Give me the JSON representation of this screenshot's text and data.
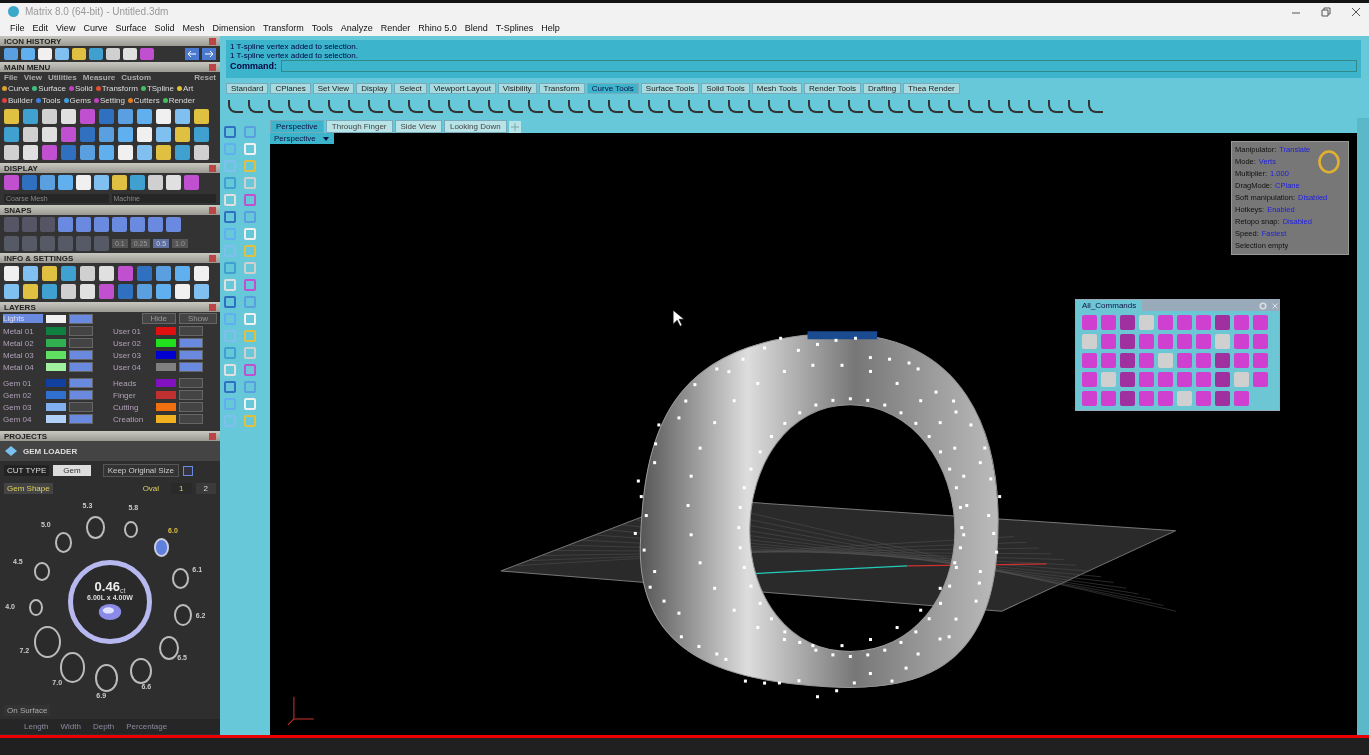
{
  "window": {
    "title": "Matrix 8.0 (64-bit) - Untitled.3dm"
  },
  "menu": [
    "File",
    "Edit",
    "View",
    "Curve",
    "Surface",
    "Solid",
    "Mesh",
    "Dimension",
    "Transform",
    "Tools",
    "Analyze",
    "Render",
    "Rhino 5.0",
    "Blend",
    "T-Splines",
    "Help"
  ],
  "icon_history": {
    "title": "ICON HISTORY"
  },
  "main_menu": {
    "title": "MAIN MENU",
    "items": [
      "File",
      "View",
      "Utilities",
      "Measure",
      "Custom"
    ],
    "reset": "Reset",
    "modules": [
      {
        "label": "Curve",
        "color": "#e0a030"
      },
      {
        "label": "Surface",
        "color": "#40c080"
      },
      {
        "label": "Solid",
        "color": "#c040c0"
      },
      {
        "label": "Transform",
        "color": "#e05030"
      },
      {
        "label": "TSpline",
        "color": "#40c060"
      },
      {
        "label": "Art",
        "color": "#e0c030"
      },
      {
        "label": "Builder",
        "color": "#e04040"
      },
      {
        "label": "Tools",
        "color": "#4080e0"
      },
      {
        "label": "Gems",
        "color": "#40a0e0"
      },
      {
        "label": "Setting",
        "color": "#c040c0"
      },
      {
        "label": "Cutters",
        "color": "#e08020"
      },
      {
        "label": "Render",
        "color": "#40c060"
      }
    ]
  },
  "display": {
    "title": "DISPLAY",
    "mesh": "Coarse Mesh",
    "material": "Machine"
  },
  "snaps": {
    "title": "SNAPS",
    "steps": [
      {
        "label": "0.1",
        "selected": false
      },
      {
        "label": "0.25",
        "selected": false
      },
      {
        "label": "0.5",
        "selected": true
      },
      {
        "label": "1.0",
        "selected": false
      }
    ]
  },
  "info_settings": {
    "title": "INFO & SETTINGS"
  },
  "layers": {
    "title": "LAYERS",
    "lights": {
      "name": "Lights",
      "on": true
    },
    "hide": "Hide",
    "show": "Show",
    "groups": [
      [
        {
          "name": "Metal 01",
          "color": "#108040",
          "on": false
        },
        {
          "name": "Metal 02",
          "color": "#30b050",
          "on": false
        },
        {
          "name": "Metal 03",
          "color": "#60e060",
          "on": true
        },
        {
          "name": "Metal 04",
          "color": "#a0f0a0",
          "on": true
        }
      ],
      [
        {
          "name": "User 01",
          "color": "#e01010",
          "on": false
        },
        {
          "name": "User 02",
          "color": "#20e020",
          "on": true
        },
        {
          "name": "User 03",
          "color": "#0000d0",
          "on": true
        },
        {
          "name": "User 04",
          "color": "#808080",
          "on": true
        }
      ],
      [
        {
          "name": "Gem 01",
          "color": "#1040a0",
          "on": true
        },
        {
          "name": "Gem 02",
          "color": "#3070d0",
          "on": true
        },
        {
          "name": "Gem 03",
          "color": "#80b0f0",
          "on": false
        },
        {
          "name": "Gem 04",
          "color": "#b0d0f8",
          "on": true
        }
      ],
      [
        {
          "name": "Heads",
          "color": "#8010c0",
          "on": false
        },
        {
          "name": "Finger",
          "color": "#c03030",
          "on": false
        },
        {
          "name": "Cutting",
          "color": "#f07010",
          "on": false
        },
        {
          "name": "Creation",
          "color": "#f0b020",
          "on": false
        }
      ]
    ]
  },
  "projects": {
    "title": "PROJECTS"
  },
  "gem_loader": {
    "title": "GEM LOADER",
    "cut_type_label": "CUT TYPE",
    "cut_type": "Gem",
    "keep_size": "Keep Original Size",
    "keep_size_checked": false,
    "shape_label": "Gem Shape",
    "shape": "Oval",
    "pages": [
      {
        "label": "1",
        "selected": true
      },
      {
        "label": "2",
        "selected": false
      }
    ],
    "carat": "0.46",
    "carat_unit": "ct",
    "dimensions": "6.00L x 4.00W",
    "sizes": [
      {
        "label": "5.8",
        "selected": false
      },
      {
        "label": "6.0",
        "selected": true
      },
      {
        "label": "6.1",
        "selected": false
      },
      {
        "label": "6.2",
        "selected": false
      },
      {
        "label": "6.5",
        "selected": false
      },
      {
        "label": "6.6",
        "selected": false
      },
      {
        "label": "6.9",
        "selected": false
      },
      {
        "label": "7.0",
        "selected": false
      },
      {
        "label": "7.2",
        "selected": false
      },
      {
        "label": "4.0",
        "selected": false
      },
      {
        "label": "4.5",
        "selected": false
      },
      {
        "label": "5.0",
        "selected": false
      },
      {
        "label": "5.3",
        "selected": false
      }
    ],
    "on_surface": "On Surface",
    "columns": [
      "Length",
      "Width",
      "Depth",
      "Percentage"
    ]
  },
  "command": {
    "history": [
      "1 T-spline vertex added to selection.",
      "1 T-spline vertex added to selection."
    ],
    "label": "Command:"
  },
  "toolbar_tabs": [
    {
      "label": "Standard",
      "selected": false
    },
    {
      "label": "CPlanes",
      "selected": false
    },
    {
      "label": "Set View",
      "selected": false
    },
    {
      "label": "Display",
      "selected": false
    },
    {
      "label": "Select",
      "selected": false
    },
    {
      "label": "Viewport Layout",
      "selected": false
    },
    {
      "label": "Visibility",
      "selected": false
    },
    {
      "label": "Transform",
      "selected": false
    },
    {
      "label": "Curve Tools",
      "selected": true
    },
    {
      "label": "Surface Tools",
      "selected": false
    },
    {
      "label": "Solid Tools",
      "selected": false
    },
    {
      "label": "Mesh Tools",
      "selected": false
    },
    {
      "label": "Render Tools",
      "selected": false
    },
    {
      "label": "Drafting",
      "selected": false
    },
    {
      "label": "Thea Render",
      "selected": false
    }
  ],
  "viewport_tabs": [
    {
      "label": "Perspective",
      "selected": true
    },
    {
      "label": "Through Finger",
      "selected": false
    },
    {
      "label": "Side View",
      "selected": false
    },
    {
      "label": "Looking Down",
      "selected": false
    }
  ],
  "viewport": {
    "label": "Perspective"
  },
  "tspline_info": [
    {
      "label": "Manipulator:",
      "value": "Translate"
    },
    {
      "label": "Mode:",
      "value": "Verts"
    },
    {
      "label": "Multiplier:",
      "value": "1.000"
    },
    {
      "label": "DragMode:",
      "value": "CPlane"
    },
    {
      "label": "Soft manipulation:",
      "value": "Disabled"
    },
    {
      "label": "Hotkeys:",
      "value": "Enabled"
    },
    {
      "label": "Retopo snap:",
      "value": "Disabled"
    },
    {
      "label": "Speed:",
      "value": "Fastest"
    },
    {
      "label": "Selection empty"
    }
  ],
  "all_commands": {
    "title": "All_Commands"
  }
}
